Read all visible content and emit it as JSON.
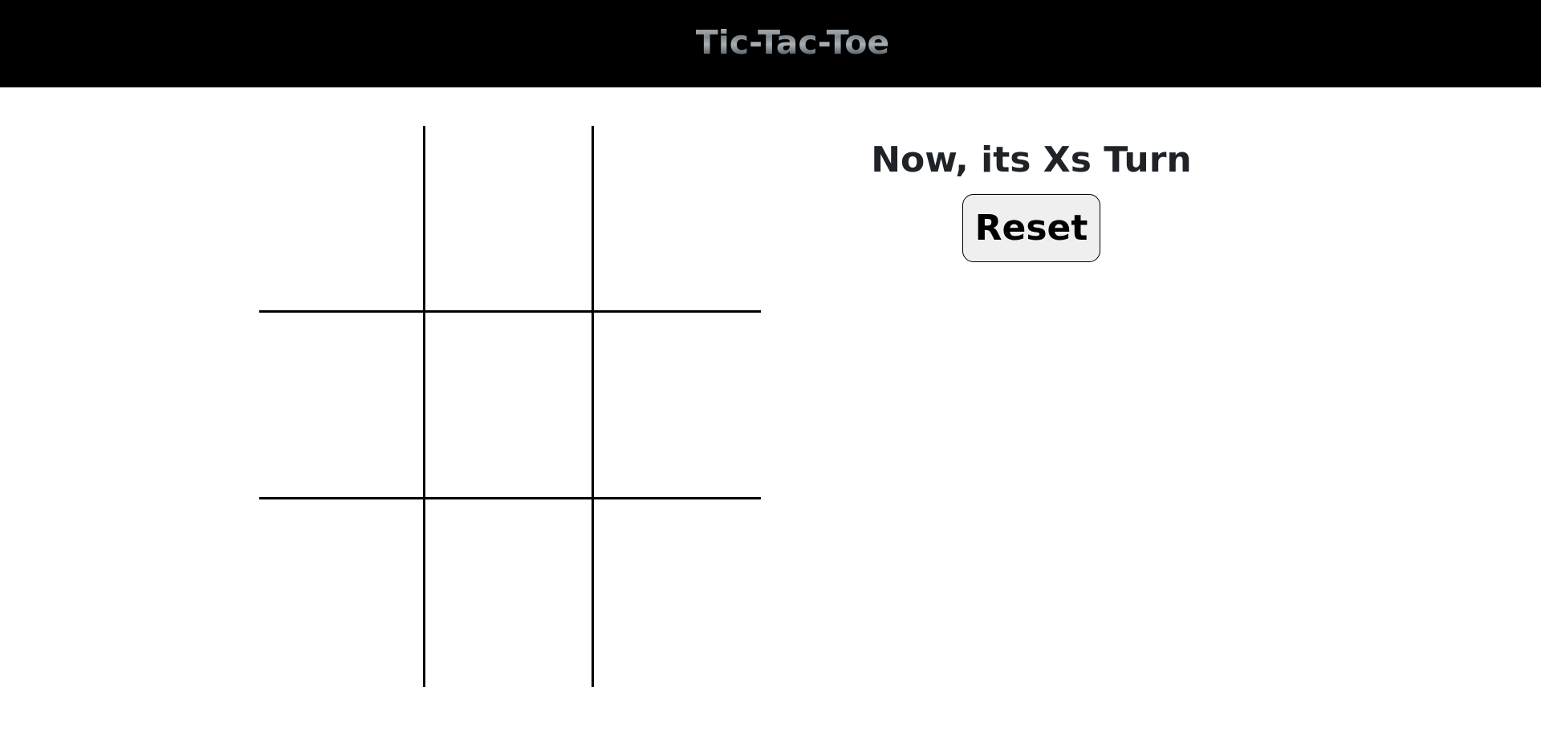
{
  "nav": {
    "title": "Tic-Tac-Toe"
  },
  "board": {
    "cells": [
      "",
      "",
      "",
      "",
      "",
      "",
      "",
      "",
      ""
    ]
  },
  "game_info": {
    "status": "Now, its Xs Turn",
    "reset_label": "Reset"
  },
  "colors": {
    "navbar_bg": "#000000",
    "grid_line": "#000000",
    "button_bg": "#efefef",
    "status_text": "#1f2328"
  }
}
